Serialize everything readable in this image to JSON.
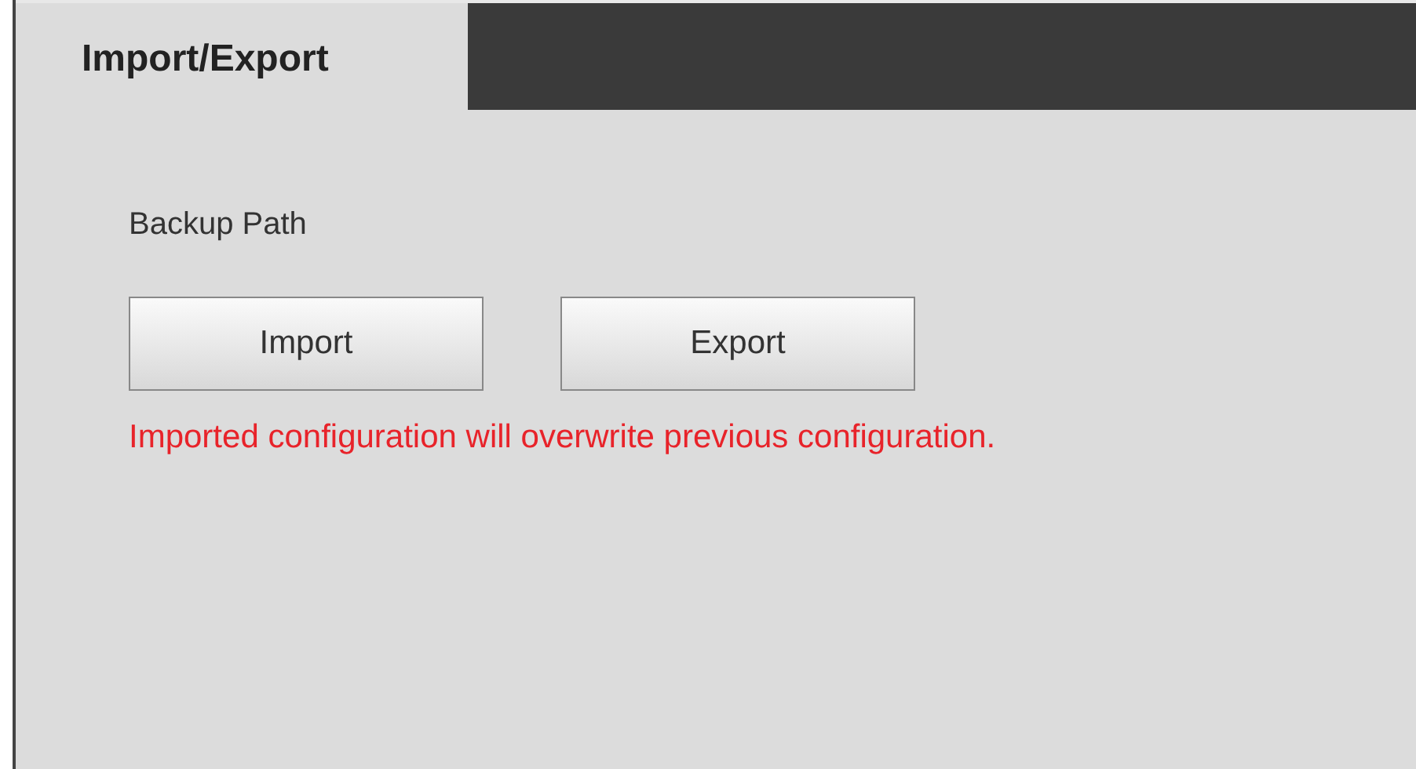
{
  "tabs": [
    {
      "label": "Import/Export",
      "selected": true
    }
  ],
  "backup_path": {
    "label": "Backup Path"
  },
  "buttons": [
    {
      "label": "Import"
    },
    {
      "label": "Export"
    }
  ],
  "warning": "Imported configuration will overwrite previous configuration."
}
